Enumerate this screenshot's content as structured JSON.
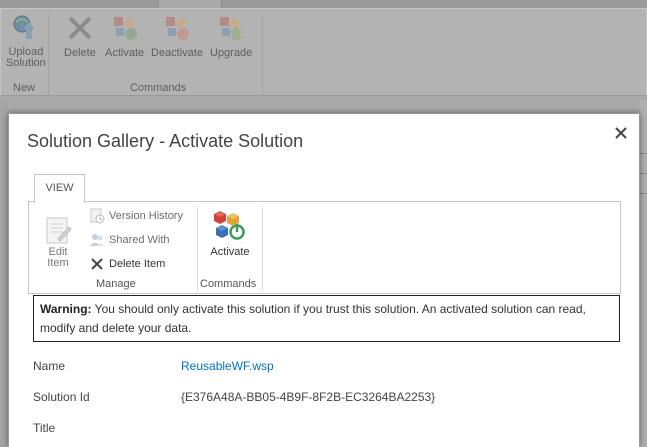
{
  "background_ribbon": {
    "buttons": [
      {
        "label_line1": "Upload",
        "label_line2": "Solution",
        "icon": "upload-solution-icon"
      },
      {
        "label": "Delete",
        "icon": "delete-x-icon"
      },
      {
        "label": "Activate",
        "icon": "activate-icon"
      },
      {
        "label": "Deactivate",
        "icon": "deactivate-icon"
      },
      {
        "label": "Upgrade",
        "icon": "upgrade-icon"
      }
    ],
    "groups": [
      "New",
      "Commands"
    ]
  },
  "dialog": {
    "title": "Solution Gallery - Activate Solution",
    "close_icon": "close-icon",
    "ribbon": {
      "tab": "VIEW",
      "manage": {
        "edit_item_line1": "Edit",
        "edit_item_line2": "Item",
        "version_history": "Version History",
        "shared_with": "Shared With",
        "delete_item": "Delete Item",
        "group_label": "Manage"
      },
      "commands": {
        "activate": "Activate",
        "group_label": "Commands"
      }
    },
    "warning": {
      "label": "Warning:",
      "text": " You should only activate this solution if you trust this solution. An activated solution can read, modify and delete your data."
    },
    "fields": [
      {
        "label": "Name",
        "value": "ReusableWF.wsp"
      },
      {
        "label": "Solution Id",
        "value": "{E376A48A-BB05-4B9F-8F2B-EC3264BA2253}"
      },
      {
        "label": "Title",
        "value": ""
      }
    ]
  },
  "colors": {
    "link": "#0072c6",
    "overlay": "#a9a9a9",
    "dialog_bg": "#ffffff"
  }
}
